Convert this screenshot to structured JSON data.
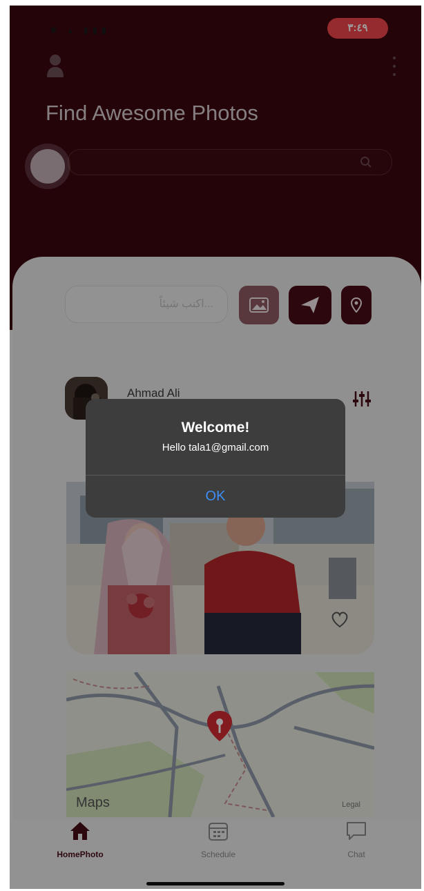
{
  "status_bar": {
    "time": "٣:٤٩"
  },
  "header": {
    "title": "Find Awesome Photos"
  },
  "composer": {
    "placeholder": "اكتب شيئاً..."
  },
  "post": {
    "author": "Ahmad Ali"
  },
  "map": {
    "brand": "Maps",
    "legal": "Legal"
  },
  "tabs": [
    {
      "label": "HomePhoto",
      "icon": "home-icon",
      "active": true
    },
    {
      "label": "Schedule",
      "icon": "calendar-icon",
      "active": false
    },
    {
      "label": "Chat",
      "icon": "chat-icon",
      "active": false
    }
  ],
  "alert": {
    "title": "Welcome!",
    "message": "Hello tala1@gmail.com",
    "ok_label": "OK"
  },
  "colors": {
    "brand": "#4a0c18",
    "alert_bg": "#3d3d3e",
    "alert_button": "#3d8ef6",
    "time_pill": "#f0464b"
  }
}
